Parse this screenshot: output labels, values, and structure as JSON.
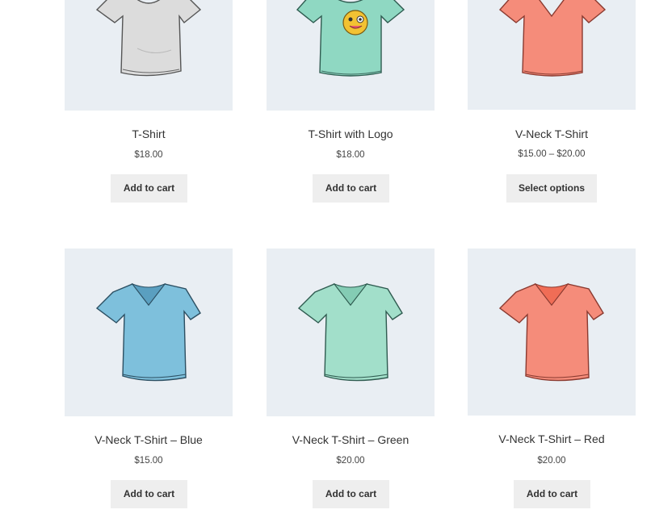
{
  "products": [
    {
      "title": "T-Shirt",
      "price": "$18.00",
      "button": "Add to cart",
      "shirt_color": "#dcdcdc",
      "shirt_icon": "plain-tshirt-icon"
    },
    {
      "title": "T-Shirt with Logo",
      "price": "$18.00",
      "button": "Add to cart",
      "shirt_color": "#8fd8c2",
      "shirt_icon": "logo-tshirt-icon",
      "logo_color": "#f2c232"
    },
    {
      "title": "V-Neck T-Shirt",
      "price": "$15.00 – $20.00",
      "button": "Select options",
      "shirt_color": "#f58c7a",
      "shirt_icon": "vneck-tshirt-icon"
    },
    {
      "title": "V-Neck T-Shirt – Blue",
      "price": "$15.00",
      "button": "Add to cart",
      "shirt_color": "#7ec0dc",
      "shirt_icon": "vneck-tshirt-icon"
    },
    {
      "title": "V-Neck T-Shirt – Green",
      "price": "$20.00",
      "button": "Add to cart",
      "shirt_color": "#a2dfca",
      "shirt_icon": "vneck-tshirt-icon"
    },
    {
      "title": "V-Neck T-Shirt – Red",
      "price": "$20.00",
      "button": "Add to cart",
      "shirt_color": "#f58c7a",
      "shirt_icon": "vneck-tshirt-icon"
    }
  ],
  "colors": {
    "thumb_background": "#e9eef3",
    "button_background": "#eeeeee",
    "text": "#333333"
  }
}
